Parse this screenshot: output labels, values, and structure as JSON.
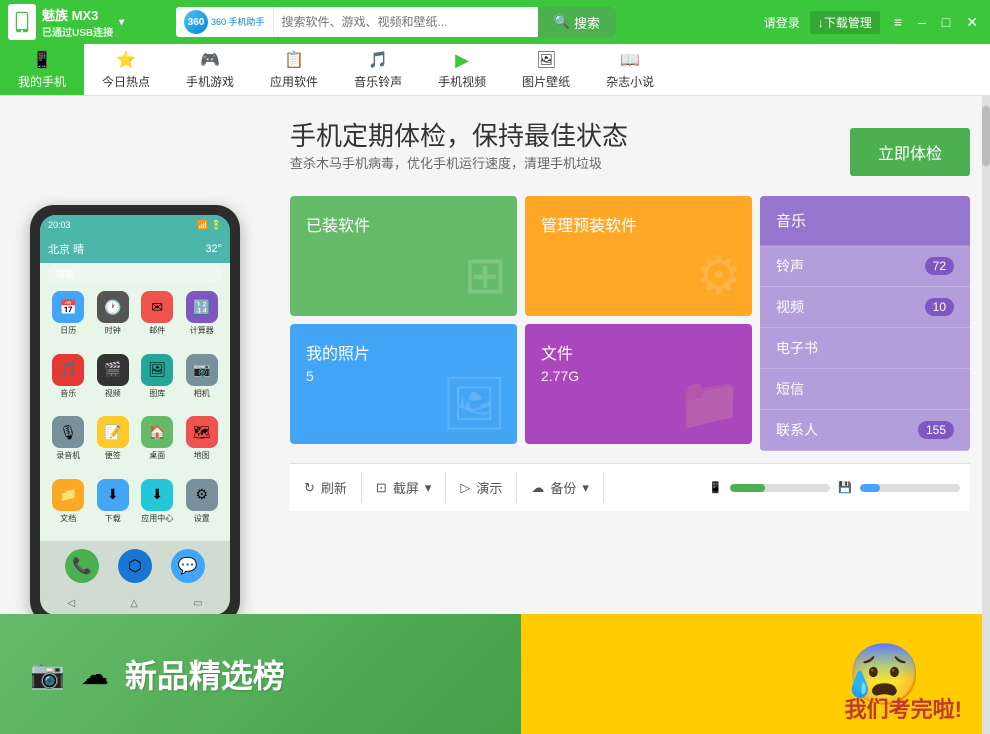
{
  "topbar": {
    "brand_name": "魅族 MX3",
    "brand_sub": "已通过USB连接",
    "brand_arrow": "▾",
    "search_placeholder": "搜索软件、游戏、视频和壁纸...",
    "search_btn_label": "搜索",
    "login_label": "请登录",
    "download_mgr_label": "↓下载管理",
    "menu_icon": "≡",
    "min_icon": "–",
    "max_icon": "□",
    "close_icon": "✕",
    "logo_text": "360\n手机助手"
  },
  "navbar": {
    "items": [
      {
        "label": "我的手机",
        "icon": "📱",
        "active": true
      },
      {
        "label": "今日热点",
        "icon": "⭐",
        "active": false
      },
      {
        "label": "手机游戏",
        "icon": "🎮",
        "active": false
      },
      {
        "label": "应用软件",
        "icon": "📋",
        "active": false
      },
      {
        "label": "音乐铃声",
        "icon": "🎵",
        "active": false
      },
      {
        "label": "手机视频",
        "icon": "▶",
        "active": false
      },
      {
        "label": "图片壁纸",
        "icon": "🖼",
        "active": false
      },
      {
        "label": "杂志小说",
        "icon": "📖",
        "active": false
      }
    ]
  },
  "phone": {
    "status_time": "20:03",
    "weather_city": "北京 晴",
    "weather_temp": "32°",
    "search_hint": "搜索",
    "apps": [
      {
        "label": "日历",
        "color": "#42a5f5",
        "icon": "📅"
      },
      {
        "label": "时钟",
        "color": "#555",
        "icon": "🕐"
      },
      {
        "label": "邮件",
        "color": "#ef5350",
        "icon": "✉"
      },
      {
        "label": "计算器",
        "color": "#7e57c2",
        "icon": "🔢"
      },
      {
        "label": "音乐",
        "color": "#e53935",
        "icon": "🎵"
      },
      {
        "label": "视频",
        "color": "#333",
        "icon": "🎬"
      },
      {
        "label": "图库",
        "color": "#26a69a",
        "icon": "🖼"
      },
      {
        "label": "相机",
        "color": "#78909c",
        "icon": "📷"
      },
      {
        "label": "录音机",
        "color": "#78909c",
        "icon": "🎙"
      },
      {
        "label": "便签",
        "color": "#ffca28",
        "icon": "📝"
      },
      {
        "label": "桌面",
        "color": "#66bb6a",
        "icon": "🏠"
      },
      {
        "label": "地图",
        "color": "#ef5350",
        "icon": "🗺"
      },
      {
        "label": "文档",
        "color": "#ffa726",
        "icon": "📁"
      },
      {
        "label": "下载",
        "color": "#42a5f5",
        "icon": "⬇"
      },
      {
        "label": "应用中心",
        "color": "#26c6da",
        "icon": "⬇"
      },
      {
        "label": "设置",
        "color": "#78909c",
        "icon": "⚙"
      }
    ]
  },
  "checkup": {
    "title": "手机定期体检，保持最佳状态",
    "desc": "查杀木马手机病毒，优化手机运行速度，清理手机垃圾",
    "btn_label": "立即体检"
  },
  "tiles": {
    "installed": {
      "label": "已装软件",
      "color": "#66bb6a"
    },
    "preinstalled": {
      "label": "管理预装软件",
      "color": "#ffa726"
    },
    "photos": {
      "label": "我的照片",
      "count": "5",
      "color": "#42a5f5"
    },
    "files": {
      "label": "文件",
      "size": "2.77G",
      "color": "#ab47bc"
    }
  },
  "sidebar": {
    "items": [
      {
        "label": "音乐",
        "badge": ""
      },
      {
        "label": "铃声",
        "badge": "72"
      },
      {
        "label": "视频",
        "badge": "10"
      },
      {
        "label": "电子书",
        "badge": ""
      },
      {
        "label": "短信",
        "badge": ""
      },
      {
        "label": "联系人",
        "badge": "155"
      }
    ]
  },
  "toolbar": {
    "refresh_label": "刷新",
    "screenshot_label": "截屏",
    "play_label": "演示",
    "backup_label": "备份"
  },
  "bottom_banner": {
    "left_text": "新品精选榜",
    "right_emoji": "😰"
  },
  "icons": {
    "refresh": "↻",
    "screenshot": "⊡",
    "play": "▷",
    "backup": "☁",
    "search": "🔍",
    "dropdown": "▾",
    "phone_small": "📱",
    "storage_left": "📱",
    "storage_right": "💾"
  }
}
